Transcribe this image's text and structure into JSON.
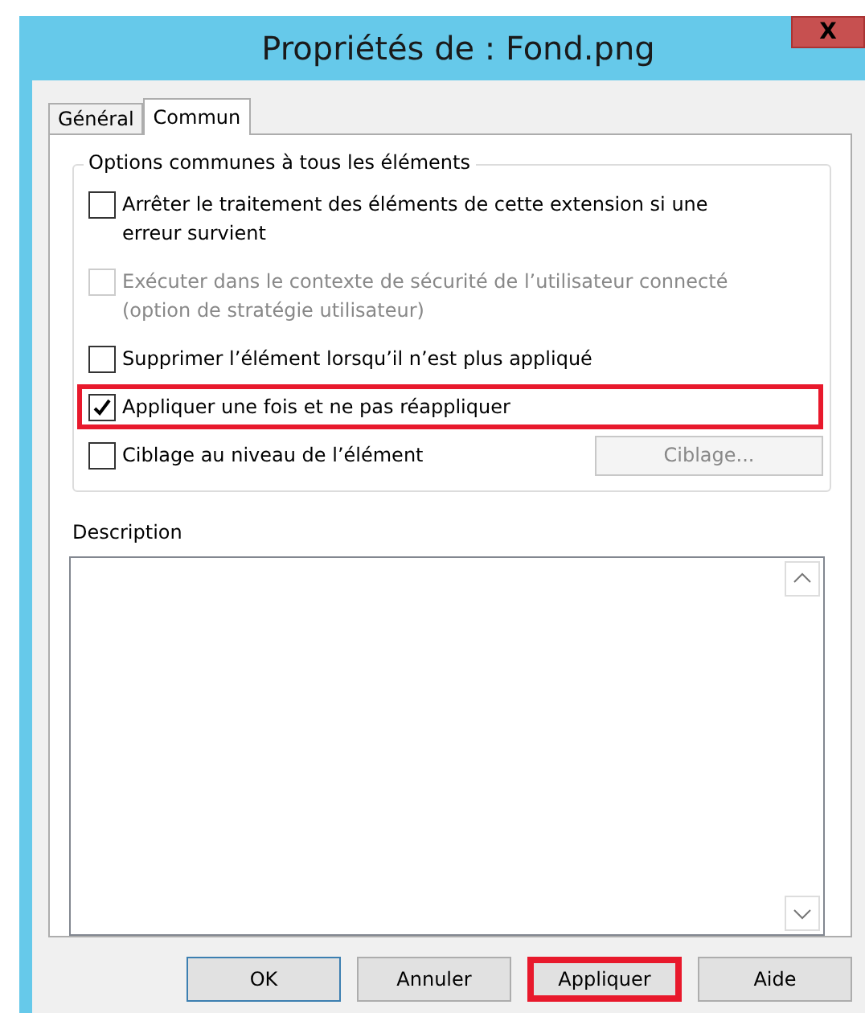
{
  "window": {
    "title": "Propriétés de : Fond.png",
    "close": "X"
  },
  "tabs": [
    {
      "label": "Général",
      "selected": false
    },
    {
      "label": "Commun",
      "selected": true
    }
  ],
  "group": {
    "title": "Options communes à tous les éléments",
    "options": [
      {
        "label": "Arrêter le traitement des éléments de cette extension si une erreur survient",
        "checked": false,
        "disabled": false,
        "highlighted": false
      },
      {
        "label": "Exécuter dans le contexte de sécurité de l’utilisateur connecté (option de stratégie utilisateur)",
        "checked": false,
        "disabled": true,
        "highlighted": false
      },
      {
        "label": "Supprimer l’élément lorsqu’il n’est plus appliqué",
        "checked": false,
        "disabled": false,
        "highlighted": false
      },
      {
        "label": "Appliquer une fois et ne pas réappliquer",
        "checked": true,
        "disabled": false,
        "highlighted": true
      },
      {
        "label": "Ciblage au niveau de l’élément",
        "checked": false,
        "disabled": false,
        "highlighted": false,
        "button": {
          "label": "Ciblage...",
          "disabled": true
        }
      }
    ]
  },
  "description": {
    "label": "Description"
  },
  "buttons": [
    {
      "label": "OK",
      "default": true,
      "highlighted": false
    },
    {
      "label": "Annuler",
      "default": false,
      "highlighted": false
    },
    {
      "label": "Appliquer",
      "default": false,
      "highlighted": true
    },
    {
      "label": "Aide",
      "default": false,
      "highlighted": false
    }
  ]
}
